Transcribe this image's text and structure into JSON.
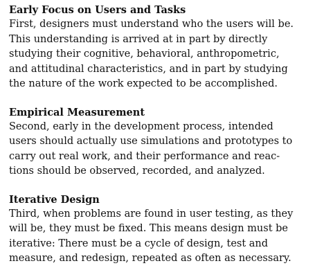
{
  "sections": [
    {
      "heading": "Early Focus on Users and Tasks",
      "lines": [
        "First, designers must understand who the users will be.",
        "This understanding is arrived at in part by directly",
        "studying their cognitive, behavioral, anthropometric,",
        "and attitudinal characteristics, and in part by studying",
        "the nature of the work expected to be accomplished."
      ]
    },
    {
      "heading": "Empirical Measurement",
      "lines": [
        "Second, early in the development process, intended",
        "users should actually use simulations and prototypes to",
        "carry out real work, and their performance and reac-",
        "tions should be observed, recorded, and analyzed."
      ]
    },
    {
      "heading": "Iterative Design",
      "lines": [
        "Third, when problems are found in user testing, as they",
        "will be, they must be fixed. This means design must be",
        "iterative: There must be a cycle of design, test and",
        "measure, and redesign, repeated as often as necessary."
      ]
    }
  ]
}
